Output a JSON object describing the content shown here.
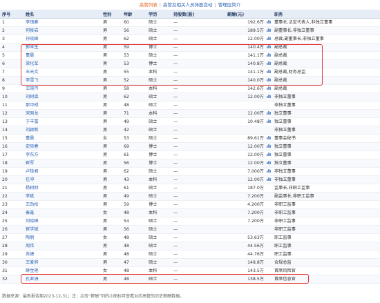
{
  "tabs": [
    {
      "label": "高管列表",
      "active": true
    },
    {
      "label": "高管及相关人员持股变动",
      "active": false
    },
    {
      "label": "管理层简介",
      "active": false
    }
  ],
  "tab_separator": "|",
  "columns": [
    "序号",
    "姓名",
    "性别",
    "年龄",
    "学历",
    "持股数(股)",
    "薪酬(元)",
    "",
    "职务"
  ],
  "rows": [
    {
      "no": "1",
      "name": "李镇春",
      "gender": "男",
      "age": "60",
      "edu": "硕士",
      "shares": "—",
      "pay": "192.6万",
      "chart": true,
      "title": "董事长,法定代表人,非独立董事"
    },
    {
      "no": "2",
      "name": "何俊岩",
      "gender": "男",
      "age": "56",
      "edu": "硕士",
      "shares": "—",
      "pay": "189.5万",
      "chart": true,
      "title": "副董事长,非独立董事"
    },
    {
      "no": "3",
      "name": "孙晓峰",
      "gender": "男",
      "age": "62",
      "edu": "硕士",
      "shares": "—",
      "pay": "12.00万",
      "chart": true,
      "title": "总裁,副董事长,非独立董事"
    },
    {
      "no": "4",
      "name": "郭丰生",
      "gender": "男",
      "age": "59",
      "edu": "博士",
      "shares": "—",
      "pay": "140.4万",
      "chart": true,
      "title": "副总裁"
    },
    {
      "no": "5",
      "name": "董晨",
      "gender": "男",
      "age": "53",
      "edu": "硕士",
      "shares": "—",
      "pay": "141.1万",
      "chart": true,
      "title": "副总裁"
    },
    {
      "no": "6",
      "name": "梁化军",
      "gender": "男",
      "age": "53",
      "edu": "博士",
      "shares": "—",
      "pay": "140.8万",
      "chart": true,
      "title": "副总裁"
    },
    {
      "no": "7",
      "name": "王天文",
      "gender": "男",
      "age": "55",
      "edu": "本科",
      "shares": "—",
      "pay": "141.1万",
      "chart": true,
      "title": "副总裁,财务总监"
    },
    {
      "no": "8",
      "name": "李雪飞",
      "gender": "男",
      "age": "52",
      "edu": "硕士",
      "shares": "—",
      "pay": "140.0万",
      "chart": true,
      "title": "副总裁"
    },
    {
      "no": "9",
      "name": "王晓丹",
      "gender": "男",
      "age": "58",
      "edu": "本科",
      "shares": "—",
      "pay": "142.6万",
      "chart": true,
      "title": "副总裁"
    },
    {
      "no": "10",
      "name": "刘树森",
      "gender": "男",
      "age": "62",
      "edu": "硕士",
      "shares": "—",
      "pay": "12.00万",
      "chart": true,
      "title": "非独立董事"
    },
    {
      "no": "11",
      "name": "那中戒",
      "gender": "男",
      "age": "48",
      "edu": "硕士",
      "shares": "—",
      "pay": "",
      "chart": false,
      "title": "非独立董事"
    },
    {
      "no": "12",
      "name": "宋刚龙",
      "gender": "男",
      "age": "71",
      "edu": "本科",
      "shares": "—",
      "pay": "12.00万",
      "chart": true,
      "title": "独立董事"
    },
    {
      "no": "13",
      "name": "于丰富",
      "gender": "男",
      "age": "49",
      "edu": "硕士",
      "shares": "—",
      "pay": "10.48万",
      "chart": true,
      "title": "独立董事"
    },
    {
      "no": "14",
      "name": "刘颖新",
      "gender": "男",
      "age": "42",
      "edu": "硕士",
      "shares": "—",
      "pay": "",
      "chart": false,
      "title": "非独立董事"
    },
    {
      "no": "15",
      "name": "董晨",
      "gender": "女",
      "age": "53",
      "edu": "硕士",
      "shares": "—",
      "pay": "89.61万",
      "chart": true,
      "title": "董事会秘书"
    },
    {
      "no": "16",
      "name": "史际春",
      "gender": "男",
      "age": "69",
      "edu": "博士",
      "shares": "—",
      "pay": "12.00万",
      "chart": true,
      "title": "独立董事"
    },
    {
      "no": "17",
      "name": "李东方",
      "gender": "男",
      "age": "61",
      "edu": "博士",
      "shares": "—",
      "pay": "12.00万",
      "chart": true,
      "title": "独立董事"
    },
    {
      "no": "18",
      "name": "崔军",
      "gender": "男",
      "age": "56",
      "edu": "博士",
      "shares": "—",
      "pay": "12.00万",
      "chart": true,
      "title": "独立董事"
    },
    {
      "no": "19",
      "name": "卢桂君",
      "gender": "男",
      "age": "62",
      "edu": "硕士",
      "shares": "—",
      "pay": "7.000万",
      "chart": true,
      "title": "非独立董事"
    },
    {
      "no": "20",
      "name": "任冲",
      "gender": "男",
      "age": "43",
      "edu": "本科",
      "shares": "—",
      "pay": "12.00万",
      "chart": true,
      "title": "非独立董事"
    },
    {
      "no": "21",
      "name": "杨树财",
      "gender": "男",
      "age": "61",
      "edu": "硕士",
      "shares": "—",
      "pay": "187.0万",
      "chart": false,
      "title": "监事长,非职工监事"
    },
    {
      "no": "22",
      "name": "李斌",
      "gender": "男",
      "age": "49",
      "edu": "硕士",
      "shares": "—",
      "pay": "7.200万",
      "chart": false,
      "title": "副监事长,非职工监事"
    },
    {
      "no": "23",
      "name": "王劲松",
      "gender": "男",
      "age": "59",
      "edu": "博士",
      "shares": "—",
      "pay": "4.200万",
      "chart": false,
      "title": "非职工监事"
    },
    {
      "no": "24",
      "name": "秦鑫",
      "gender": "女",
      "age": "48",
      "edu": "本科",
      "shares": "—",
      "pay": "7.200万",
      "chart": false,
      "title": "非职工监事"
    },
    {
      "no": "25",
      "name": "刘晓峰",
      "gender": "男",
      "age": "54",
      "edu": "硕士",
      "shares": "—",
      "pay": "7.200万",
      "chart": false,
      "title": "非职工监事"
    },
    {
      "no": "26",
      "name": "崔学斌",
      "gender": "男",
      "age": "56",
      "edu": "硕士",
      "shares": "—",
      "pay": "",
      "chart": false,
      "title": "非职工监事"
    },
    {
      "no": "27",
      "name": "陶丽",
      "gender": "女",
      "age": "48",
      "edu": "硕士",
      "shares": "—",
      "pay": "53.63万",
      "chart": false,
      "title": "职工监事"
    },
    {
      "no": "28",
      "name": "周伟",
      "gender": "男",
      "age": "48",
      "edu": "硕士",
      "shares": "—",
      "pay": "44.56万",
      "chart": false,
      "title": "职工监事"
    },
    {
      "no": "29",
      "name": "苏捷",
      "gender": "男",
      "age": "48",
      "edu": "硕士",
      "shares": "—",
      "pay": "44.76万",
      "chart": false,
      "title": "职工监事"
    },
    {
      "no": "30",
      "name": "王爱宾",
      "gender": "男",
      "age": "47",
      "edu": "硕士",
      "shares": "—",
      "pay": "148.8万",
      "chart": false,
      "title": "合规总监"
    },
    {
      "no": "31",
      "name": "薛金艳",
      "gender": "女",
      "age": "48",
      "edu": "本科",
      "shares": "—",
      "pay": "143.5万",
      "chart": false,
      "title": "首席风险官"
    },
    {
      "no": "32",
      "name": "孔亚洲",
      "gender": "男",
      "age": "48",
      "edu": "硕士",
      "shares": "—",
      "pay": "138.5万",
      "chart": false,
      "title": "首席信息官"
    }
  ],
  "footnote": "数据来源：最新报告期2023-12-31；注：点击“薪酬”列的小图标可查看对应高管的历史薪酬数据。",
  "colors": {
    "accent": "#2b63b6",
    "active_tab": "#e4661b",
    "header_bg": "#e7edf6",
    "highlight": "#e23a3a",
    "chart_icon": "#4a78c2"
  }
}
